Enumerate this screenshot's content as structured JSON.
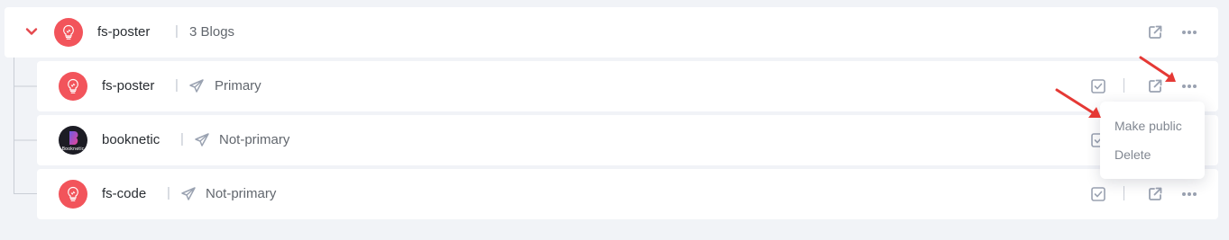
{
  "parent": {
    "name": "fs-poster",
    "separator": "|",
    "blog_count": "3 Blogs"
  },
  "blogs": [
    {
      "name": "fs-poster",
      "separator": "|",
      "status": "Primary",
      "avatar": "bulb-logo"
    },
    {
      "name": "booknetic",
      "separator": "|",
      "status": "Not-primary",
      "avatar": "booknetic-logo",
      "avatar_text": "Booknetic"
    },
    {
      "name": "fs-code",
      "separator": "|",
      "status": "Not-primary",
      "avatar": "bulb-logo"
    }
  ],
  "dropdown": {
    "items": [
      "Make public",
      "Delete"
    ]
  },
  "colors": {
    "brand_red": "#f2545b",
    "annotation_arrow": "#e53935",
    "icon_gray": "#9aa2b1",
    "background": "#f1f3f7"
  }
}
